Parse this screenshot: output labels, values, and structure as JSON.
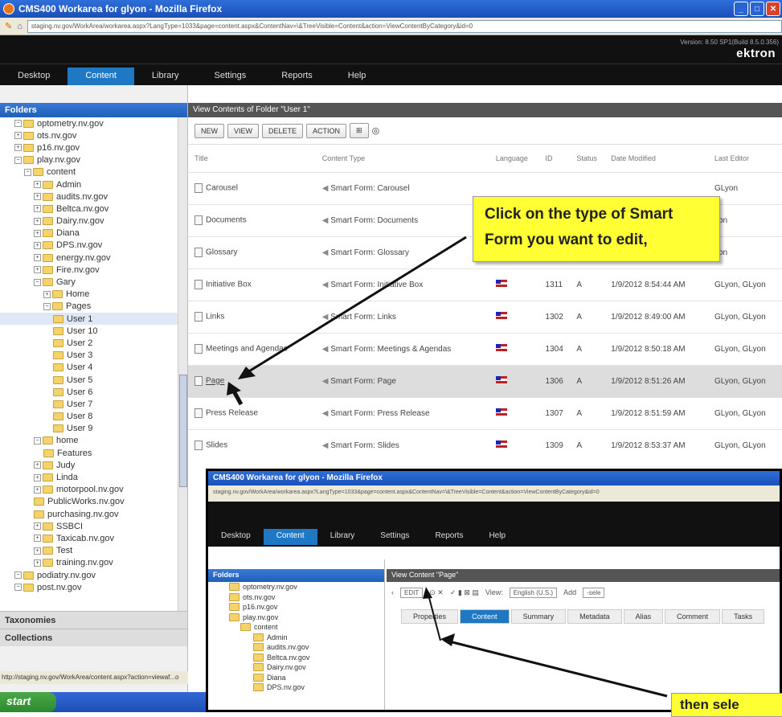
{
  "window": {
    "title": "CMS400 Workarea for glyon - Mozilla Firefox",
    "url": "staging.nv.gov/WorkArea/workarea.aspx?LangType=1033&page=content.aspx&ContentNav=\\&TreeVisible=Content&action=ViewContentByCategory&id=0"
  },
  "nav": {
    "items": [
      "Desktop",
      "Content",
      "Library",
      "Settings",
      "Reports",
      "Help"
    ],
    "brand": "ektron",
    "version": "Version: 8.50 SP1(Build 8.5.0.356)"
  },
  "sidebar": {
    "title": "Folders",
    "tree": [
      {
        "label": "optometry.nv.gov",
        "indent": 1,
        "exp": "⊟"
      },
      {
        "label": "ots.nv.gov",
        "indent": 1,
        "exp": "⊞"
      },
      {
        "label": "p16.nv.gov",
        "indent": 1,
        "exp": "⊞"
      },
      {
        "label": "play.nv.gov",
        "indent": 1,
        "exp": "⊟"
      },
      {
        "label": "content",
        "indent": 2,
        "exp": "⊟"
      },
      {
        "label": "Admin",
        "indent": 3,
        "exp": "⊞"
      },
      {
        "label": "audits.nv.gov",
        "indent": 3,
        "exp": "⊞"
      },
      {
        "label": "Beltca.nv.gov",
        "indent": 3,
        "exp": "⊞"
      },
      {
        "label": "Dairy.nv.gov",
        "indent": 3,
        "exp": "⊞"
      },
      {
        "label": "Diana",
        "indent": 3,
        "exp": "⊞"
      },
      {
        "label": "DPS.nv.gov",
        "indent": 3,
        "exp": "⊞"
      },
      {
        "label": "energy.nv.gov",
        "indent": 3,
        "exp": "⊞"
      },
      {
        "label": "Fire.nv.gov",
        "indent": 3,
        "exp": "⊞"
      },
      {
        "label": "Gary",
        "indent": 3,
        "exp": "⊟"
      },
      {
        "label": "Home",
        "indent": 4,
        "exp": "⊞"
      },
      {
        "label": "Pages",
        "indent": 4,
        "exp": "⊟"
      },
      {
        "label": "User 1",
        "indent": 5,
        "exp": ""
      },
      {
        "label": "User 10",
        "indent": 5,
        "exp": ""
      },
      {
        "label": "User 2",
        "indent": 5,
        "exp": ""
      },
      {
        "label": "User 3",
        "indent": 5,
        "exp": ""
      },
      {
        "label": "User 4",
        "indent": 5,
        "exp": ""
      },
      {
        "label": "User 5",
        "indent": 5,
        "exp": ""
      },
      {
        "label": "User 6",
        "indent": 5,
        "exp": ""
      },
      {
        "label": "User 7",
        "indent": 5,
        "exp": ""
      },
      {
        "label": "User 8",
        "indent": 5,
        "exp": ""
      },
      {
        "label": "User 9",
        "indent": 5,
        "exp": ""
      },
      {
        "label": "home",
        "indent": 3,
        "exp": "⊟"
      },
      {
        "label": "Features",
        "indent": 4,
        "exp": ""
      },
      {
        "label": "Judy",
        "indent": 3,
        "exp": "⊞"
      },
      {
        "label": "Linda",
        "indent": 3,
        "exp": "⊞"
      },
      {
        "label": "motorpool.nv.gov",
        "indent": 3,
        "exp": "⊞"
      },
      {
        "label": "PublicWorks.nv.gov",
        "indent": 3,
        "exp": ""
      },
      {
        "label": "purchasing.nv.gov",
        "indent": 3,
        "exp": ""
      },
      {
        "label": "SSBCI",
        "indent": 3,
        "exp": "⊞"
      },
      {
        "label": "Taxicab.nv.gov",
        "indent": 3,
        "exp": "⊞"
      },
      {
        "label": "Test",
        "indent": 3,
        "exp": "⊞"
      },
      {
        "label": "training.nv.gov",
        "indent": 3,
        "exp": "⊞"
      },
      {
        "label": "podiatry.nv.gov",
        "indent": 1,
        "exp": "⊟"
      },
      {
        "label": "post.nv.gov",
        "indent": 1,
        "exp": "⊟"
      }
    ],
    "taxonomies": "Taxonomies",
    "collections": "Collections"
  },
  "status": "http://staging.nv.gov/WorkArea/content.aspx?action=viewaf...o",
  "taskbar": {
    "start": "start"
  },
  "main": {
    "title": "View Contents of Folder \"User 1\"",
    "buttons": [
      "NEW",
      "VIEW",
      "DELETE",
      "ACTION"
    ],
    "columns": [
      "Title",
      "Content Type",
      "Language",
      "ID",
      "Status",
      "Date Modified",
      "Last Editor"
    ],
    "rows": [
      {
        "title": "Carousel",
        "type": "Smart Form: Carousel",
        "lang": "",
        "id": "",
        "status": "",
        "date": "",
        "editor": "GLyon"
      },
      {
        "title": "Documents",
        "type": "Smart Form: Documents",
        "lang": "",
        "id": "",
        "status": "",
        "date": "",
        "editor": "yon"
      },
      {
        "title": "Glossary",
        "type": "Smart Form: Glossary",
        "lang": "",
        "id": "",
        "status": "",
        "date": "",
        "editor": "yon"
      },
      {
        "title": "Initiative Box",
        "type": "Smart Form: Initiative Box",
        "lang": "flag",
        "id": "1311",
        "status": "A",
        "date": "1/9/2012 8:54:44 AM",
        "editor": "GLyon, GLyon"
      },
      {
        "title": "Links",
        "type": "Smart Form: Links",
        "lang": "flag",
        "id": "1302",
        "status": "A",
        "date": "1/9/2012 8:49:00 AM",
        "editor": "GLyon, GLyon"
      },
      {
        "title": "Meetings and Agendas",
        "type": "Smart Form: Meetings & Agendas",
        "lang": "flag",
        "id": "1304",
        "status": "A",
        "date": "1/9/2012 8:50:18 AM",
        "editor": "GLyon, GLyon"
      },
      {
        "title": "Page",
        "type": "Smart Form: Page",
        "lang": "flag",
        "id": "1306",
        "status": "A",
        "date": "1/9/2012 8:51:26 AM",
        "editor": "GLyon, GLyon"
      },
      {
        "title": "Press Release",
        "type": "Smart Form: Press Release",
        "lang": "flag",
        "id": "1307",
        "status": "A",
        "date": "1/9/2012 8:51:59 AM",
        "editor": "GLyon, GLyon"
      },
      {
        "title": "Slides",
        "type": "Smart Form: Slides",
        "lang": "flag",
        "id": "1309",
        "status": "A",
        "date": "1/9/2012 8:53:37 AM",
        "editor": "GLyon, GLyon"
      }
    ]
  },
  "callout": {
    "line1": "Click on the type of Smart",
    "line2": "Form you want to edit,"
  },
  "inset": {
    "title": "CMS400 Workarea for glyon - Mozilla Firefox",
    "url": "staging.nv.gov/WorkArea/workarea.aspx?LangType=1033&page=content.aspx&ContentNav=\\&TreeVisible=Content&action=ViewContentByCategory&id=0",
    "nav": [
      "Desktop",
      "Content",
      "Library",
      "Settings",
      "Reports",
      "Help"
    ],
    "sidebar_title": "Folders",
    "tree": [
      "optometry.nv.gov",
      "ots.nv.gov",
      "p16.nv.gov",
      "play.nv.gov",
      "content",
      "Admin",
      "audits.nv.gov",
      "Beltca.nv.gov",
      "Dairy.nv.gov",
      "Diana",
      "DPS.nv.gov"
    ],
    "main_title": "View Content \"Page\"",
    "edit": "EDIT",
    "view_label": "View:",
    "view_value": "English (U.S.)",
    "add_label": "Add",
    "add_value": "-sele",
    "tabs": [
      "Properties",
      "Content",
      "Summary",
      "Metadata",
      "Alias",
      "Comment",
      "Tasks"
    ]
  },
  "callout2": "then sele"
}
